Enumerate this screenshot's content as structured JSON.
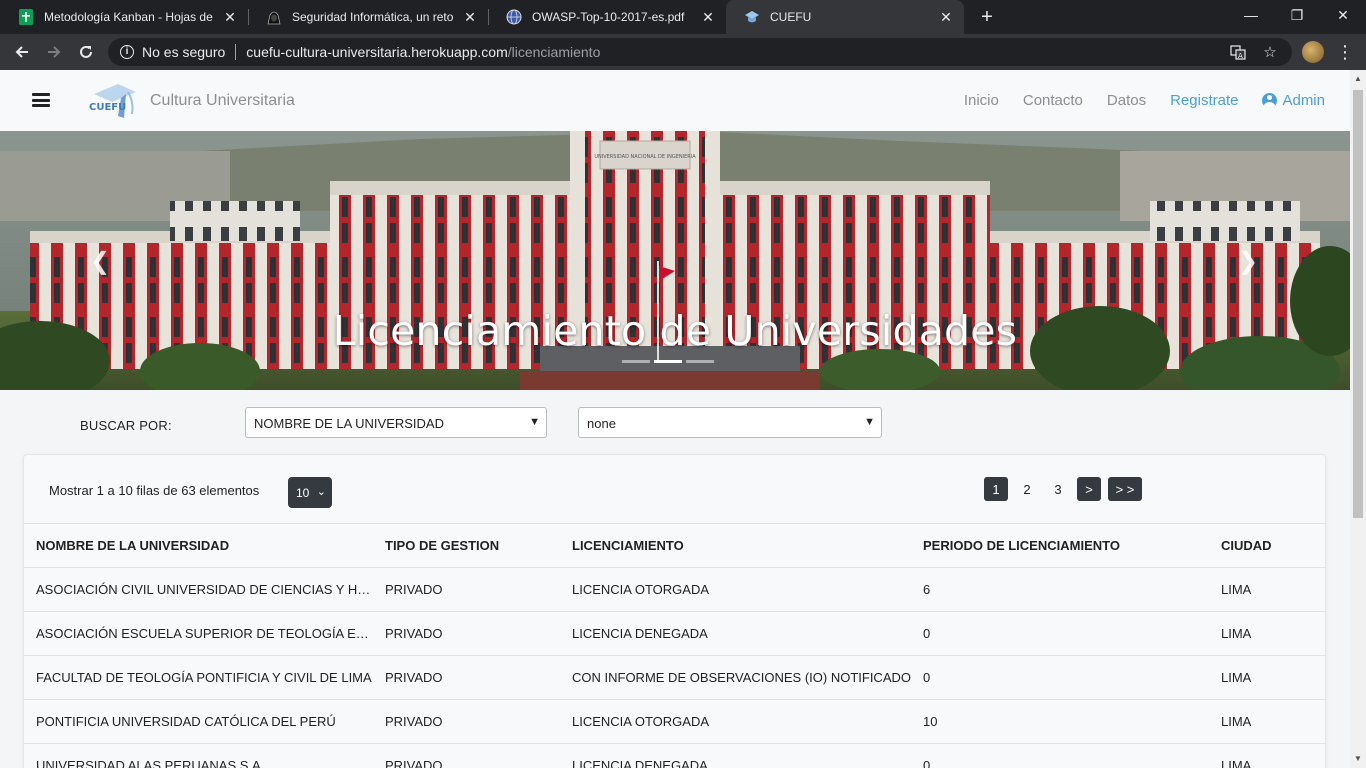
{
  "browser": {
    "tabs": [
      {
        "label": "Metodología Kanban - Hojas de c",
        "icon": "sheets-icon"
      },
      {
        "label": "Seguridad Informática, un reto pa",
        "icon": "hacker-icon"
      },
      {
        "label": "OWASP-Top-10-2017-es.pdf",
        "icon": "globe-icon"
      },
      {
        "label": "CUEFU",
        "icon": "graduation-cap-icon",
        "active": true
      }
    ],
    "security_label": "No es seguro",
    "url_domain": "cuefu-cultura-universitaria.herokuapp.com",
    "url_path": "/licenciamiento"
  },
  "site": {
    "brand": "Cultura Universitaria",
    "logo_text": "CUEFU",
    "nav": {
      "inicio": "Inicio",
      "contacto": "Contacto",
      "datos": "Datos",
      "registrate": "Registrate",
      "admin": "Admin"
    }
  },
  "hero": {
    "caption": "Licenciamiento de Universidades",
    "building_text": "UNIVERSIDAD NACIONAL DE INGENIERIA"
  },
  "search": {
    "label": "BUSCAR POR:",
    "field_value": "NOMBRE DE LA UNIVERSIDAD",
    "filter_value": "none"
  },
  "table": {
    "summary": "Mostrar 1 a 10 filas de 63 elementos",
    "page_size": "10",
    "pager": {
      "p1": "1",
      "p2": "2",
      "p3": "3",
      "next": ">",
      "last": "> >"
    },
    "headers": {
      "name": "NOMBRE DE LA UNIVERSIDAD",
      "gestion": "TIPO DE GESTION",
      "licencia": "LICENCIAMIENTO",
      "periodo": "PERIODO DE LICENCIAMIENTO",
      "ciudad": "CIUDAD"
    },
    "rows": [
      {
        "name": "ASOCIACIÓN CIVIL UNIVERSIDAD DE CIENCIAS Y HUM...",
        "gestion": "PRIVADO",
        "licencia": "LICENCIA OTORGADA",
        "periodo": "6",
        "ciudad": "LIMA"
      },
      {
        "name": "ASOCIACIÓN ESCUELA SUPERIOR DE TEOLOGÍA EVAN...",
        "gestion": "PRIVADO",
        "licencia": "LICENCIA DENEGADA",
        "periodo": "0",
        "ciudad": "LIMA"
      },
      {
        "name": "FACULTAD DE TEOLOGÍA PONTIFICIA Y CIVIL DE LIMA",
        "gestion": "PRIVADO",
        "licencia": "CON INFORME DE OBSERVACIONES (IO) NOTIFICADO",
        "periodo": "0",
        "ciudad": "LIMA"
      },
      {
        "name": "PONTIFICIA UNIVERSIDAD CATÓLICA DEL PERÚ",
        "gestion": "PRIVADO",
        "licencia": "LICENCIA OTORGADA",
        "periodo": "10",
        "ciudad": "LIMA"
      },
      {
        "name": "UNIVERSIDAD ALAS PERUANAS S.A.",
        "gestion": "PRIVADO",
        "licencia": "LICENCIA DENEGADA",
        "periodo": "0",
        "ciudad": "LIMA"
      }
    ]
  }
}
